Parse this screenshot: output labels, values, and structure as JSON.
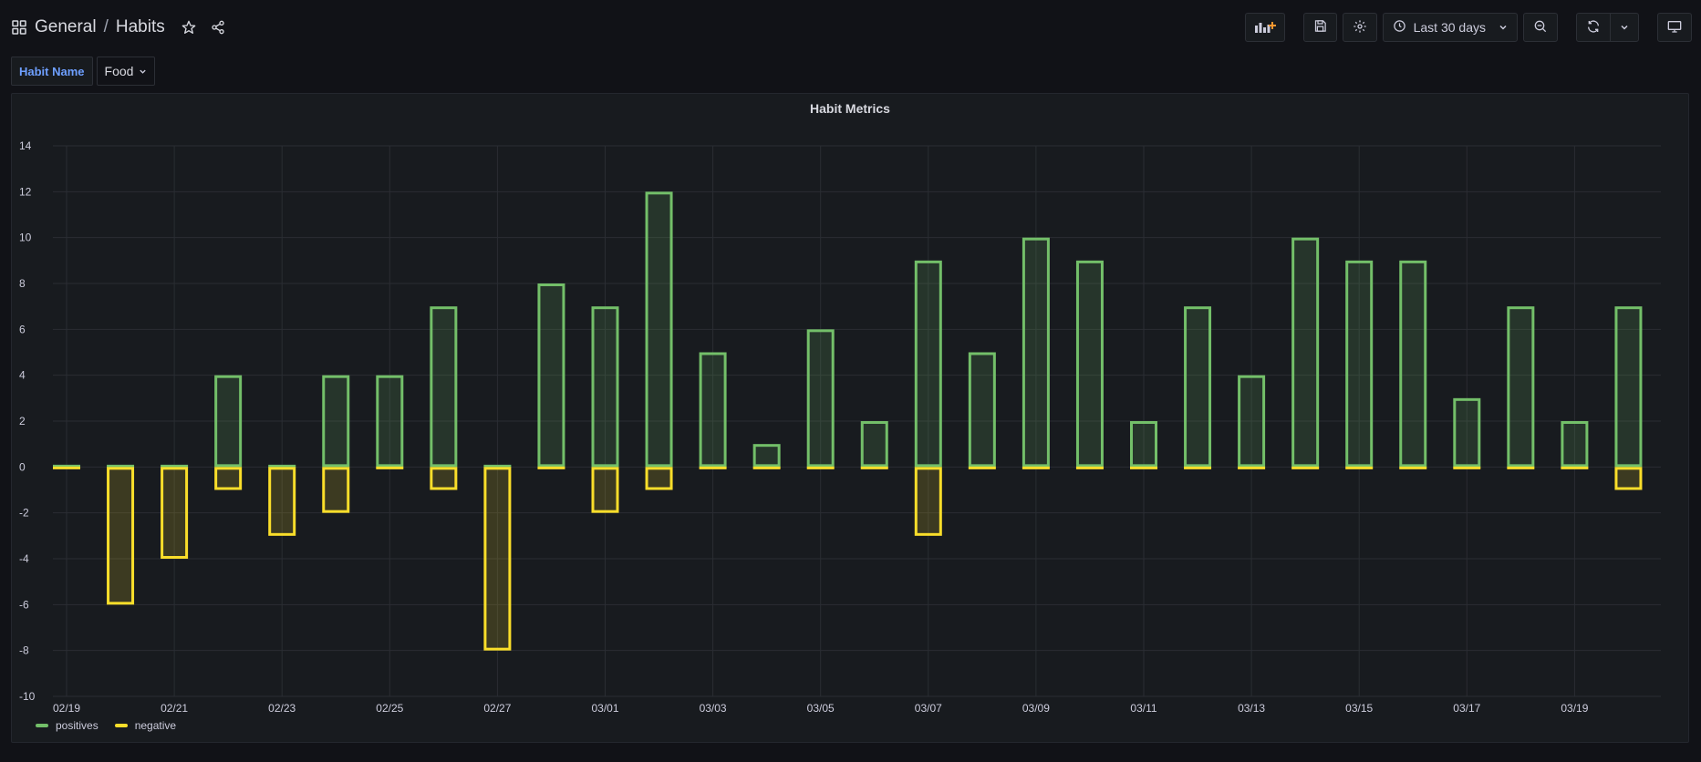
{
  "breadcrumb": {
    "folder": "General",
    "separator": "/",
    "dashboard": "Habits"
  },
  "toolbar": {
    "time_range": "Last 30 days"
  },
  "variables": {
    "label": "Habit Name",
    "value": "Food"
  },
  "colors": {
    "positives": "#73bf69",
    "negative": "#fade2a",
    "grid": "#2a2d33",
    "axis_text": "#ccccdc"
  },
  "icons": {
    "apps": "apps-grid-icon",
    "star": "star-icon",
    "share": "share-icon",
    "add_panel": "add-panel-icon",
    "save": "save-icon",
    "settings": "gear-icon",
    "clock": "clock-icon",
    "zoom_out": "zoom-out-icon",
    "refresh": "refresh-icon",
    "chevron": "chevron-down-icon",
    "tv": "tv-mode-icon"
  },
  "chart_data": {
    "type": "bar",
    "title": "Habit Metrics",
    "x_tick_labels": [
      "02/19",
      "02/21",
      "02/23",
      "02/25",
      "02/27",
      "03/01",
      "03/03",
      "03/05",
      "03/07",
      "03/09",
      "03/11",
      "03/13",
      "03/15",
      "03/17",
      "03/19"
    ],
    "ylim": [
      -10,
      14
    ],
    "y_ticks": [
      14,
      12,
      10,
      8,
      6,
      4,
      2,
      0,
      -2,
      -4,
      -6,
      -8,
      -10
    ],
    "grid": true,
    "legend_position": "bottom-left",
    "series": [
      {
        "name": "positives",
        "values": [
          0,
          0,
          0,
          4,
          0,
          4,
          4,
          7,
          0,
          8,
          7,
          12,
          5,
          1,
          6,
          2,
          9,
          5,
          10,
          9,
          2,
          7,
          4,
          10,
          9,
          9,
          3,
          7,
          2,
          7
        ]
      },
      {
        "name": "negative",
        "values": [
          0,
          -6,
          -4,
          -1,
          -3,
          -2,
          0,
          -1,
          -8,
          0,
          -2,
          -1,
          0,
          0,
          0,
          0,
          -3,
          0,
          0,
          0,
          0,
          0,
          0,
          0,
          0,
          0,
          0,
          0,
          0,
          -1
        ]
      }
    ]
  }
}
